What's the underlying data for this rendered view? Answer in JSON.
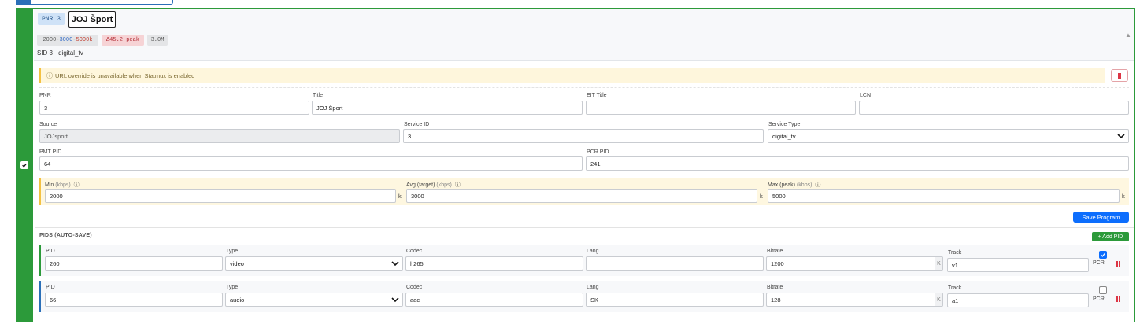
{
  "program": {
    "pnr_badge": "PNR 3",
    "title": "JOJ Šport",
    "rates": {
      "min": "2000",
      "avg": "3000",
      "max": "5000k"
    },
    "peak_badge": "Δ45.2 peak",
    "mux_badge": "3.0M",
    "sid_line": "SID 3 · digital_tv",
    "selected": true
  },
  "warning": {
    "icon": "ⓘ",
    "text": "URL override is unavailable when Statmux is enabled"
  },
  "form": {
    "pnr": {
      "label": "PNR",
      "value": "3"
    },
    "title": {
      "label": "Title",
      "value": "JOJ Šport"
    },
    "eit_title": {
      "label": "EIT Title",
      "value": ""
    },
    "lcn": {
      "label": "LCN",
      "value": ""
    },
    "source": {
      "label": "Source",
      "value": "JOJsport"
    },
    "service_id": {
      "label": "Service ID",
      "value": "3"
    },
    "service_type": {
      "label": "Service Type",
      "value": "digital_tv"
    },
    "pmt_pid": {
      "label": "PMT PID",
      "value": "64"
    },
    "pcr_pid": {
      "label": "PCR PID",
      "value": "241"
    },
    "min": {
      "label": "Min",
      "unit": "(kbps)",
      "value": "2000"
    },
    "avg": {
      "label": "Avg (target)",
      "unit": "(kbps)",
      "value": "3000"
    },
    "max": {
      "label": "Max (peak)",
      "unit": "(kbps)",
      "value": "5000"
    },
    "k_suffix": "k",
    "info_icon": "ⓘ",
    "save_label": "Save Program"
  },
  "pids": {
    "title": "PIDS (AUTO-SAVE)",
    "add_label": "+ Add PID",
    "headers": {
      "pid": "PID",
      "type": "Type",
      "codec": "Codec",
      "lang": "Lang",
      "bitrate": "Bitrate",
      "track": "Track",
      "pcr": "PCR"
    },
    "bitrate_unit": "K",
    "rows": [
      {
        "pid": "260",
        "type": "video",
        "codec": "h265",
        "lang": "",
        "bitrate": "1200",
        "track": "v1",
        "pcr": true
      },
      {
        "pid": "66",
        "type": "audio",
        "codec": "aac",
        "lang": "SK",
        "bitrate": "128",
        "track": "a1",
        "pcr": false
      }
    ]
  },
  "colors": {
    "accent": "#0d6efd",
    "success": "#2c9a3a",
    "warning": "#f4c142",
    "danger": "#dc3545"
  }
}
